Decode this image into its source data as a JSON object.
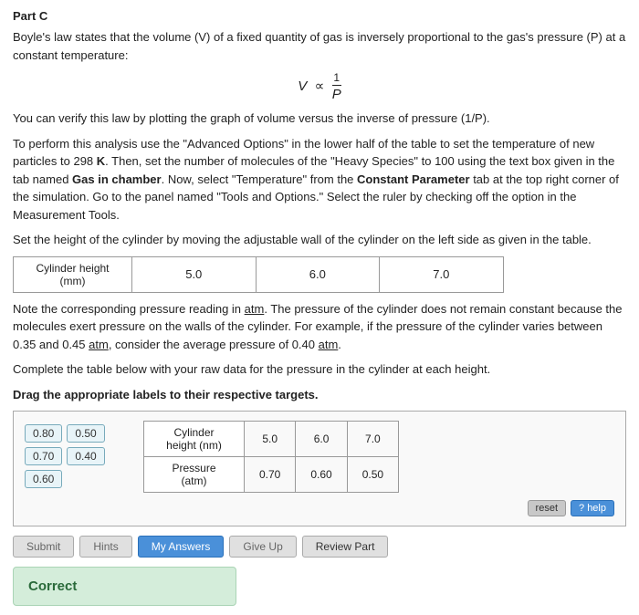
{
  "part": {
    "label": "Part C"
  },
  "paragraphs": {
    "p1": "Boyle's law states that the volume (V) of a fixed quantity of gas is inversely proportional to the gas's pressure (P) at a constant temperature:",
    "formula_text": "V ∝ 1/P",
    "p2": "You can verify this law by plotting the graph of volume versus the inverse of pressure (1/P).",
    "p3": "To perform this analysis use the \"Advanced Options\" in the lower half of the table to set the temperature of new particles to 298 K. Then, set the number of molecules of the \"Heavy Species\" to 100 using the text box given in the tab named Gas in chamber. Now, select \"Temperature\" from the Constant Parameter tab at the top right corner of the simulation. Go to the panel named \"Tools and Options.\" Select the ruler by checking off the option in the Measurement Tools.",
    "p4": "Set the height of the cylinder by moving the adjustable wall of the cylinder on the left side as given in the table.",
    "p5": "Note the corresponding pressure reading in atm. The pressure of the cylinder does not remain constant because the molecules exert pressure on the walls of the cylinder. For example, if the pressure of the cylinder varies between 0.35 and 0.45 atm, consider the average pressure of 0.40 atm.",
    "p6": "Complete the table below with your raw data for the pressure in the cylinder at each height.",
    "p7": "Drag the appropriate labels to their respective targets."
  },
  "height_table": {
    "header": "Cylinder height (mm)",
    "values": [
      "5.0",
      "6.0",
      "7.0"
    ]
  },
  "drag_labels": {
    "col1": [
      "0.80",
      "0.70",
      "0.60"
    ],
    "col2": [
      "0.50",
      "0.40"
    ]
  },
  "inner_table": {
    "row1_header": "Cylinder height (nm)",
    "row1_values": [
      "5.0",
      "6.0",
      "7.0"
    ],
    "row2_header": "Pressure (atm)",
    "row2_values": [
      "0.70",
      "0.60",
      "0.50"
    ]
  },
  "buttons": {
    "reset": "reset",
    "help": "? help",
    "submit": "Submit",
    "hints": "Hints",
    "my_answers": "My Answers",
    "give_up": "Give Up",
    "review_part": "Review Part"
  },
  "correct": {
    "label": "Correct"
  }
}
